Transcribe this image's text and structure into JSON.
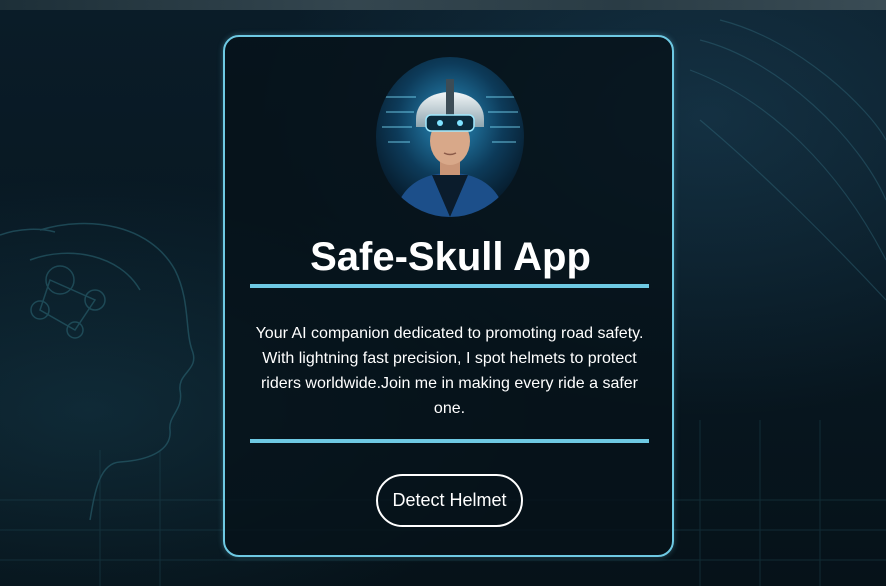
{
  "card": {
    "avatar_icon": "helmeted-rider-avatar",
    "title": "Safe-Skull App",
    "tagline": "Your AI companion dedicated to promoting road safety. With lightning fast precision, I spot helmets to protect riders worldwide.Join me in making every ride a safer one.",
    "detect_button_label": "Detect Helmet"
  },
  "colors": {
    "accent": "#6ec9e3",
    "background": "#081822",
    "text": "#ffffff"
  }
}
